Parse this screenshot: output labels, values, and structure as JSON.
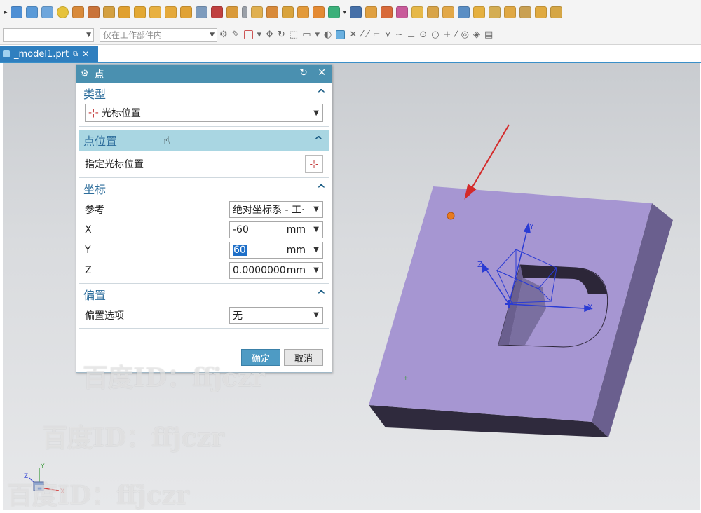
{
  "toolbar": {
    "icons": [
      "block-icon",
      "cylinder-icon",
      "cone-icon",
      "sphere-icon",
      "book-icon",
      "shield-icon",
      "inxs-icon",
      "cube-icon",
      "cube-icon",
      "cube-icon",
      "cube-icon",
      "cube-icon",
      "cylinder-icon",
      "cube-icon",
      "cube-icon",
      "battery-icon",
      "disk-icon",
      "stairs-icon",
      "layers-icon",
      "grid-icon",
      "puzzle-icon",
      "pin-icon",
      "bars-icon",
      "box-icon",
      "arrow-icon",
      "flag-icon",
      "plate-icon",
      "cube-icon",
      "spring-icon",
      "cube-icon",
      "cube-icon",
      "cube-icon",
      "cube-icon",
      "cube-icon"
    ],
    "filter_placeholder": "",
    "scope_value": "仅在工作部件内"
  },
  "tabbar": {
    "tab_label": "_model1.prt"
  },
  "dialog": {
    "title": "点",
    "sections": {
      "type": {
        "label": "类型",
        "value": "光标位置"
      },
      "point_location": {
        "label": "点位置",
        "specify_label": "指定光标位置"
      },
      "coordinates": {
        "label": "坐标",
        "reference_label": "参考",
        "reference_value": "绝对坐标系 - 工·",
        "x_label": "X",
        "x_value": "-60",
        "x_unit": "mm",
        "y_label": "Y",
        "y_value": "60",
        "y_unit": "mm",
        "z_label": "Z",
        "z_value": "0.0000000",
        "z_unit": "mm"
      },
      "offset": {
        "label": "偏置",
        "option_label": "偏置选项",
        "option_value": "无"
      }
    },
    "ok_label": "确定",
    "cancel_label": "取消"
  },
  "model": {
    "axis_x": "X",
    "axis_y": "Y",
    "axis_z": "Z",
    "triad_x": "X",
    "triad_y": "Y",
    "triad_z": "Z"
  },
  "watermarks": [
    "百度ID：ffjczr",
    "百度ID：ffjczr",
    "百度ID：ffjczr"
  ],
  "colors": {
    "accent": "#4a90b0",
    "tab": "#2f7fbf",
    "section_active": "#a9d6e2",
    "model_top": "#a696d2",
    "ok_button": "#4e9bc4",
    "arrow": "#d42a2a"
  }
}
